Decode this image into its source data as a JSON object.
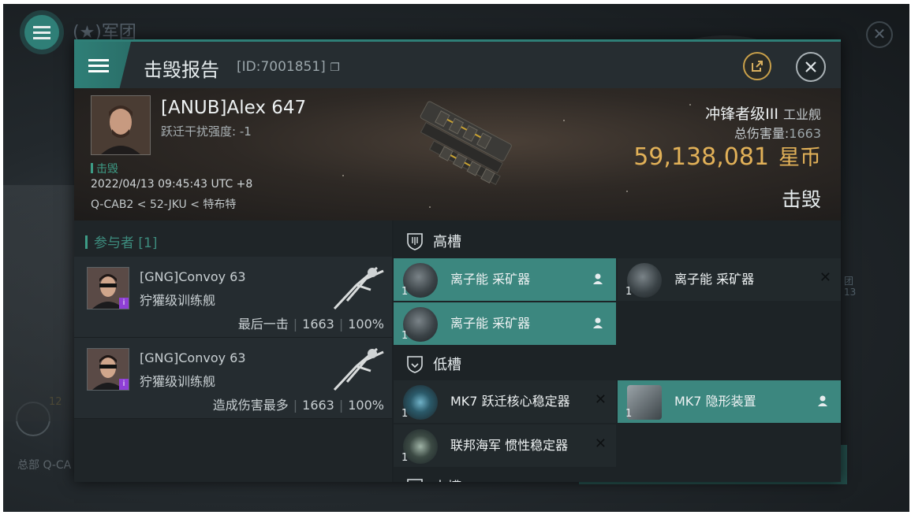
{
  "background": {
    "title": "(★)军团",
    "hq_label": "总部 Q-CA",
    "badge_num": "12",
    "right_text": [
      "团",
      "13"
    ]
  },
  "header": {
    "title": "击毁报告",
    "id": "[ID:7001851]",
    "share_icon": "share-icon",
    "close_icon": "close-icon"
  },
  "victim": {
    "name": "[ANUB]Alex 647",
    "warp_label": "跃迁干扰强度:",
    "warp_value": "-1",
    "status_tag": "击毁",
    "timestamp": "2022/04/13 09:45:43 UTC +8",
    "location": "Q-CAB2 < 52-JKU < 特布特",
    "ship_class": "冲锋者级III",
    "ship_type": "工业舰",
    "total_damage_label": "总伤害量:",
    "total_damage_value": "1663",
    "isk_value": "59,138,081",
    "isk_unit": "星币",
    "result": "击毁"
  },
  "participants": {
    "header": "参与者 [1]",
    "list": [
      {
        "name": "[GNG]Convoy 63",
        "ship": "狞獾级训练舰",
        "role": "最后一击",
        "damage": "1663",
        "percent": "100%"
      },
      {
        "name": "[GNG]Convoy 63",
        "ship": "狞獾级训练舰",
        "role": "造成伤害最多",
        "damage": "1663",
        "percent": "100%"
      }
    ]
  },
  "slots": {
    "high": {
      "label": "高槽",
      "modules": [
        {
          "name": "离子能 采矿器",
          "qty": "1",
          "state": "fitted"
        },
        {
          "name": "离子能 采矿器",
          "qty": "1",
          "state": "destroyed"
        },
        {
          "name": "离子能 采矿器",
          "qty": "1",
          "state": "fitted"
        }
      ]
    },
    "low": {
      "label": "低槽",
      "modules": [
        {
          "name": "MK7 跃迁核心稳定器",
          "qty": "1",
          "state": "destroyed"
        },
        {
          "name": "MK7 隐形装置",
          "qty": "1",
          "state": "fitted"
        },
        {
          "name": "联邦海军 惯性稳定器",
          "qty": "1",
          "state": "destroyed"
        }
      ]
    },
    "mid": {
      "label": "中槽"
    }
  },
  "colors": {
    "accent": "#2f7f77",
    "fitted_bg": "#3c877f",
    "isk_gold": "#e2b158",
    "share_ring": "#c9a04a"
  }
}
